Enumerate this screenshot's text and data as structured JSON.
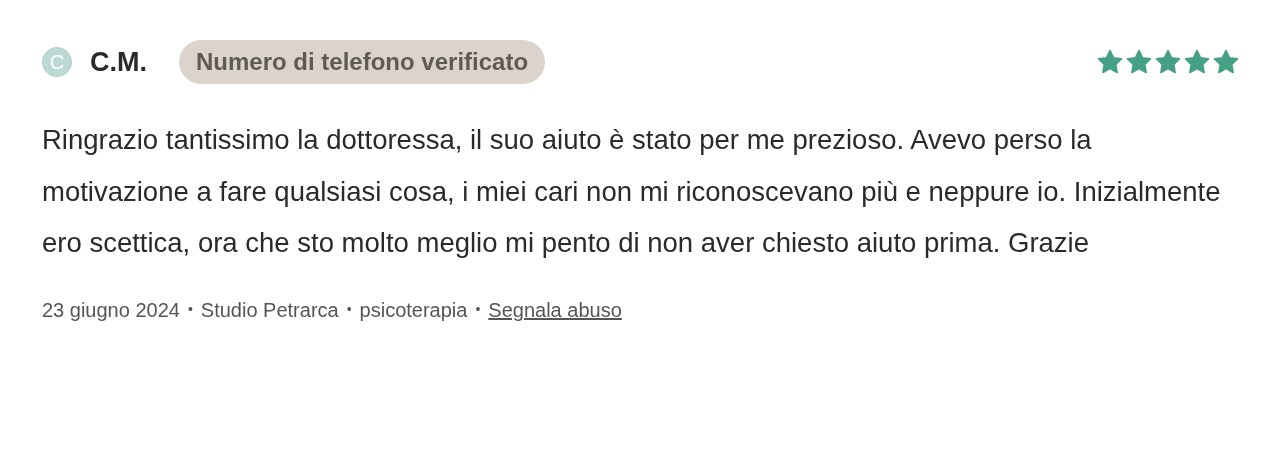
{
  "review": {
    "avatar_letter": "C",
    "author": "C.M.",
    "badge": "Numero di telefono verificato",
    "stars": 5,
    "text": "Ringrazio tantissimo la dottoressa, il suo aiuto è stato per me prezioso. Avevo perso la motivazione a fare qualsiasi cosa, i miei cari non mi riconoscevano più e neppure io. Inizialmente ero scettica, ora che sto molto meglio mi pento di non aver chiesto aiuto prima. Grazie",
    "meta": [
      {
        "kind": "text",
        "text": "23 giugno 2024"
      },
      {
        "kind": "text",
        "text": "Studio Petrarca"
      },
      {
        "kind": "text",
        "text": "psicoterapia"
      },
      {
        "kind": "link",
        "text": "Segnala abuso"
      }
    ],
    "separator": "•"
  }
}
